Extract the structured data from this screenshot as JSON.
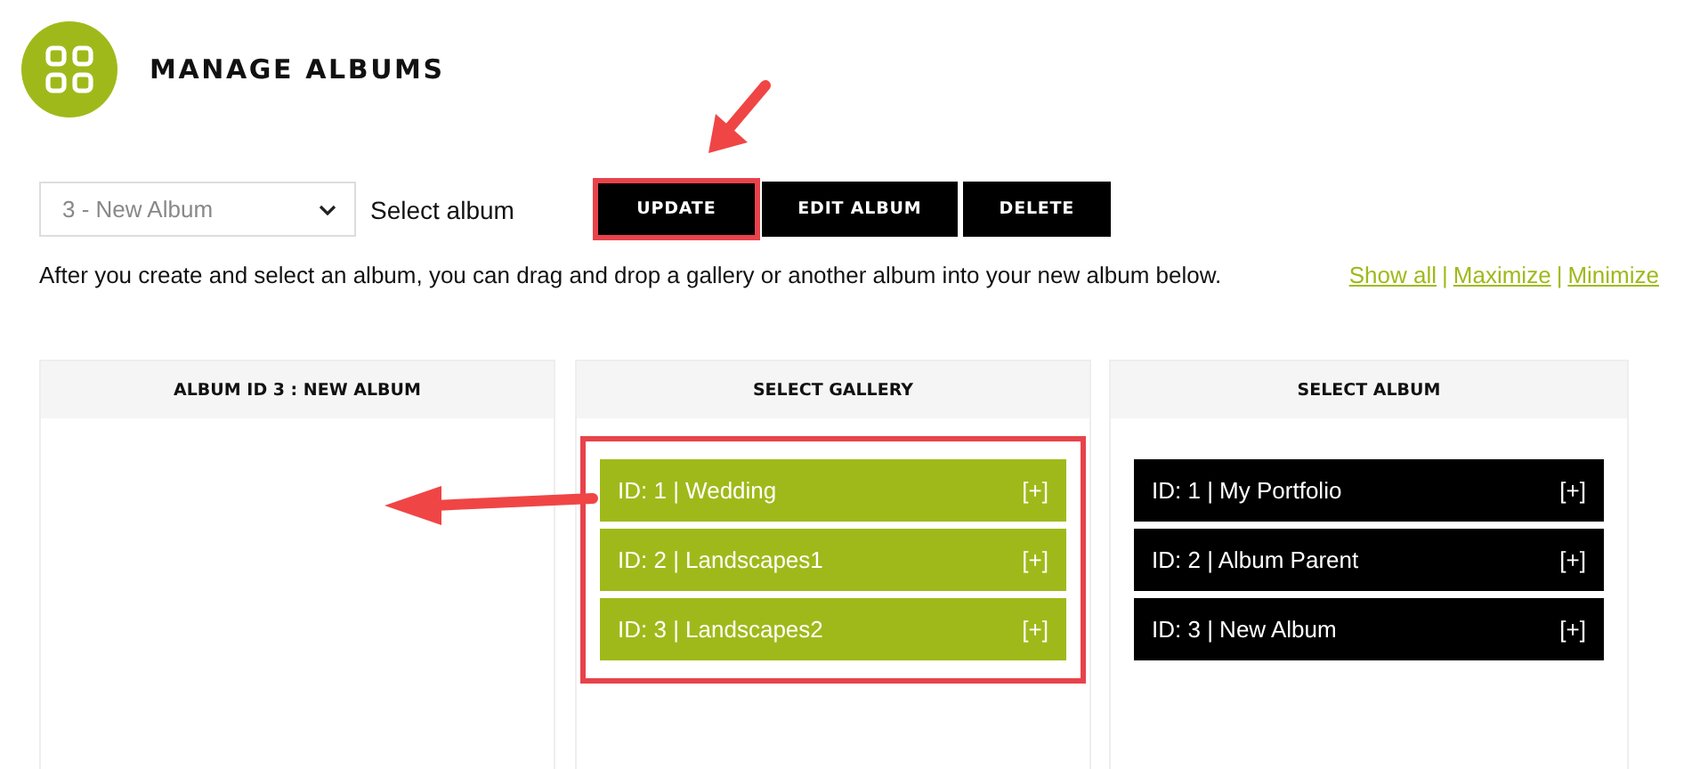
{
  "page_title": "MANAGE ALBUMS",
  "album_select": {
    "value": "3 - New Album",
    "label": "Select album"
  },
  "buttons": [
    {
      "label": "UPDATE",
      "highlighted": true
    },
    {
      "label": "EDIT ALBUM",
      "highlighted": false
    },
    {
      "label": "DELETE",
      "highlighted": false
    }
  ],
  "description": "After you create and select an album, you can drag and drop a gallery or another album into your new album below.",
  "view_links": [
    "Show all",
    "Maximize",
    "Minimize"
  ],
  "view_link_separators": [
    "|",
    "|"
  ],
  "panels": [
    {
      "title": "ALBUM ID 3 : NEW ALBUM"
    },
    {
      "title": "SELECT GALLERY",
      "kind": "gallery",
      "highlighted": true,
      "items": [
        {
          "label": "ID: 1 | Wedding",
          "add": "[+]"
        },
        {
          "label": "ID: 2 | Landscapes1",
          "add": "[+]"
        },
        {
          "label": "ID: 3 | Landscapes2",
          "add": "[+]"
        }
      ]
    },
    {
      "title": "SELECT ALBUM",
      "kind": "album",
      "items": [
        {
          "label": "ID: 1 | My Portfolio",
          "add": "[+]"
        },
        {
          "label": "ID: 2 | Album Parent",
          "add": "[+]"
        },
        {
          "label": "ID: 3 | New Album",
          "add": "[+]"
        }
      ]
    }
  ]
}
